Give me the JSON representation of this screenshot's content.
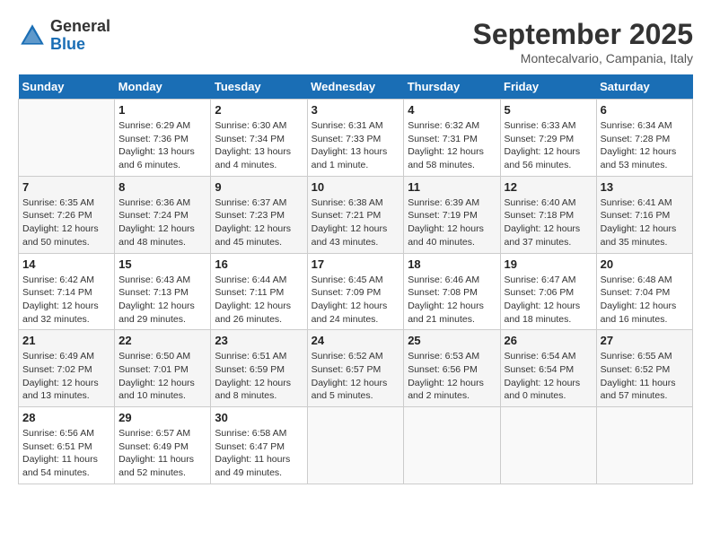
{
  "header": {
    "logo_general": "General",
    "logo_blue": "Blue",
    "month_title": "September 2025",
    "location": "Montecalvario, Campania, Italy"
  },
  "days_of_week": [
    "Sunday",
    "Monday",
    "Tuesday",
    "Wednesday",
    "Thursday",
    "Friday",
    "Saturday"
  ],
  "weeks": [
    [
      {
        "num": "",
        "sunrise": "",
        "sunset": "",
        "daylight": ""
      },
      {
        "num": "1",
        "sunrise": "Sunrise: 6:29 AM",
        "sunset": "Sunset: 7:36 PM",
        "daylight": "Daylight: 13 hours and 6 minutes."
      },
      {
        "num": "2",
        "sunrise": "Sunrise: 6:30 AM",
        "sunset": "Sunset: 7:34 PM",
        "daylight": "Daylight: 13 hours and 4 minutes."
      },
      {
        "num": "3",
        "sunrise": "Sunrise: 6:31 AM",
        "sunset": "Sunset: 7:33 PM",
        "daylight": "Daylight: 13 hours and 1 minute."
      },
      {
        "num": "4",
        "sunrise": "Sunrise: 6:32 AM",
        "sunset": "Sunset: 7:31 PM",
        "daylight": "Daylight: 12 hours and 58 minutes."
      },
      {
        "num": "5",
        "sunrise": "Sunrise: 6:33 AM",
        "sunset": "Sunset: 7:29 PM",
        "daylight": "Daylight: 12 hours and 56 minutes."
      },
      {
        "num": "6",
        "sunrise": "Sunrise: 6:34 AM",
        "sunset": "Sunset: 7:28 PM",
        "daylight": "Daylight: 12 hours and 53 minutes."
      }
    ],
    [
      {
        "num": "7",
        "sunrise": "Sunrise: 6:35 AM",
        "sunset": "Sunset: 7:26 PM",
        "daylight": "Daylight: 12 hours and 50 minutes."
      },
      {
        "num": "8",
        "sunrise": "Sunrise: 6:36 AM",
        "sunset": "Sunset: 7:24 PM",
        "daylight": "Daylight: 12 hours and 48 minutes."
      },
      {
        "num": "9",
        "sunrise": "Sunrise: 6:37 AM",
        "sunset": "Sunset: 7:23 PM",
        "daylight": "Daylight: 12 hours and 45 minutes."
      },
      {
        "num": "10",
        "sunrise": "Sunrise: 6:38 AM",
        "sunset": "Sunset: 7:21 PM",
        "daylight": "Daylight: 12 hours and 43 minutes."
      },
      {
        "num": "11",
        "sunrise": "Sunrise: 6:39 AM",
        "sunset": "Sunset: 7:19 PM",
        "daylight": "Daylight: 12 hours and 40 minutes."
      },
      {
        "num": "12",
        "sunrise": "Sunrise: 6:40 AM",
        "sunset": "Sunset: 7:18 PM",
        "daylight": "Daylight: 12 hours and 37 minutes."
      },
      {
        "num": "13",
        "sunrise": "Sunrise: 6:41 AM",
        "sunset": "Sunset: 7:16 PM",
        "daylight": "Daylight: 12 hours and 35 minutes."
      }
    ],
    [
      {
        "num": "14",
        "sunrise": "Sunrise: 6:42 AM",
        "sunset": "Sunset: 7:14 PM",
        "daylight": "Daylight: 12 hours and 32 minutes."
      },
      {
        "num": "15",
        "sunrise": "Sunrise: 6:43 AM",
        "sunset": "Sunset: 7:13 PM",
        "daylight": "Daylight: 12 hours and 29 minutes."
      },
      {
        "num": "16",
        "sunrise": "Sunrise: 6:44 AM",
        "sunset": "Sunset: 7:11 PM",
        "daylight": "Daylight: 12 hours and 26 minutes."
      },
      {
        "num": "17",
        "sunrise": "Sunrise: 6:45 AM",
        "sunset": "Sunset: 7:09 PM",
        "daylight": "Daylight: 12 hours and 24 minutes."
      },
      {
        "num": "18",
        "sunrise": "Sunrise: 6:46 AM",
        "sunset": "Sunset: 7:08 PM",
        "daylight": "Daylight: 12 hours and 21 minutes."
      },
      {
        "num": "19",
        "sunrise": "Sunrise: 6:47 AM",
        "sunset": "Sunset: 7:06 PM",
        "daylight": "Daylight: 12 hours and 18 minutes."
      },
      {
        "num": "20",
        "sunrise": "Sunrise: 6:48 AM",
        "sunset": "Sunset: 7:04 PM",
        "daylight": "Daylight: 12 hours and 16 minutes."
      }
    ],
    [
      {
        "num": "21",
        "sunrise": "Sunrise: 6:49 AM",
        "sunset": "Sunset: 7:02 PM",
        "daylight": "Daylight: 12 hours and 13 minutes."
      },
      {
        "num": "22",
        "sunrise": "Sunrise: 6:50 AM",
        "sunset": "Sunset: 7:01 PM",
        "daylight": "Daylight: 12 hours and 10 minutes."
      },
      {
        "num": "23",
        "sunrise": "Sunrise: 6:51 AM",
        "sunset": "Sunset: 6:59 PM",
        "daylight": "Daylight: 12 hours and 8 minutes."
      },
      {
        "num": "24",
        "sunrise": "Sunrise: 6:52 AM",
        "sunset": "Sunset: 6:57 PM",
        "daylight": "Daylight: 12 hours and 5 minutes."
      },
      {
        "num": "25",
        "sunrise": "Sunrise: 6:53 AM",
        "sunset": "Sunset: 6:56 PM",
        "daylight": "Daylight: 12 hours and 2 minutes."
      },
      {
        "num": "26",
        "sunrise": "Sunrise: 6:54 AM",
        "sunset": "Sunset: 6:54 PM",
        "daylight": "Daylight: 12 hours and 0 minutes."
      },
      {
        "num": "27",
        "sunrise": "Sunrise: 6:55 AM",
        "sunset": "Sunset: 6:52 PM",
        "daylight": "Daylight: 11 hours and 57 minutes."
      }
    ],
    [
      {
        "num": "28",
        "sunrise": "Sunrise: 6:56 AM",
        "sunset": "Sunset: 6:51 PM",
        "daylight": "Daylight: 11 hours and 54 minutes."
      },
      {
        "num": "29",
        "sunrise": "Sunrise: 6:57 AM",
        "sunset": "Sunset: 6:49 PM",
        "daylight": "Daylight: 11 hours and 52 minutes."
      },
      {
        "num": "30",
        "sunrise": "Sunrise: 6:58 AM",
        "sunset": "Sunset: 6:47 PM",
        "daylight": "Daylight: 11 hours and 49 minutes."
      },
      {
        "num": "",
        "sunrise": "",
        "sunset": "",
        "daylight": ""
      },
      {
        "num": "",
        "sunrise": "",
        "sunset": "",
        "daylight": ""
      },
      {
        "num": "",
        "sunrise": "",
        "sunset": "",
        "daylight": ""
      },
      {
        "num": "",
        "sunrise": "",
        "sunset": "",
        "daylight": ""
      }
    ]
  ]
}
